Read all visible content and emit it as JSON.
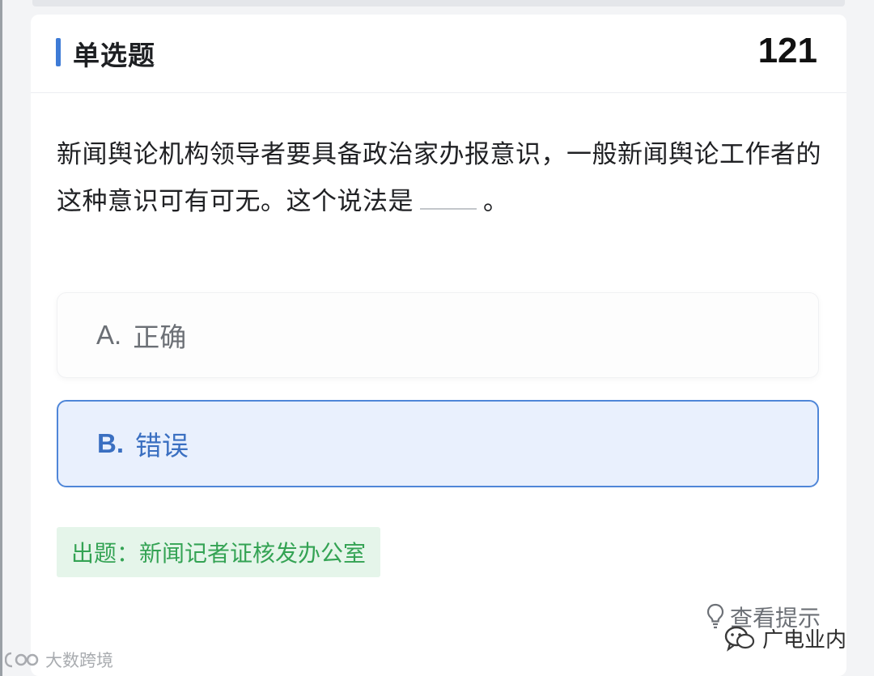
{
  "header": {
    "question_type": "单选题",
    "question_number": "121"
  },
  "question": {
    "text_before_blank": "新闻舆论机构领导者要具备政治家办报意识，一般新闻舆论工作者的这种意识可有可无。这个说法是",
    "text_after_blank": "。"
  },
  "options": [
    {
      "letter": "A.",
      "text": "正确",
      "selected": false
    },
    {
      "letter": "B.",
      "text": "错误",
      "selected": true
    }
  ],
  "source_tag": "出题：新闻记者证核发办公室",
  "hint_label": "查看提示",
  "hint_icon": "lightbulb-icon",
  "watermark_left": "大数跨境",
  "watermark_right": "广电业内",
  "colors": {
    "accent_blue": "#3e7bd6",
    "selected_bg": "#e9f0fd",
    "source_green": "#34a354",
    "source_bg": "#e5f5ea"
  }
}
